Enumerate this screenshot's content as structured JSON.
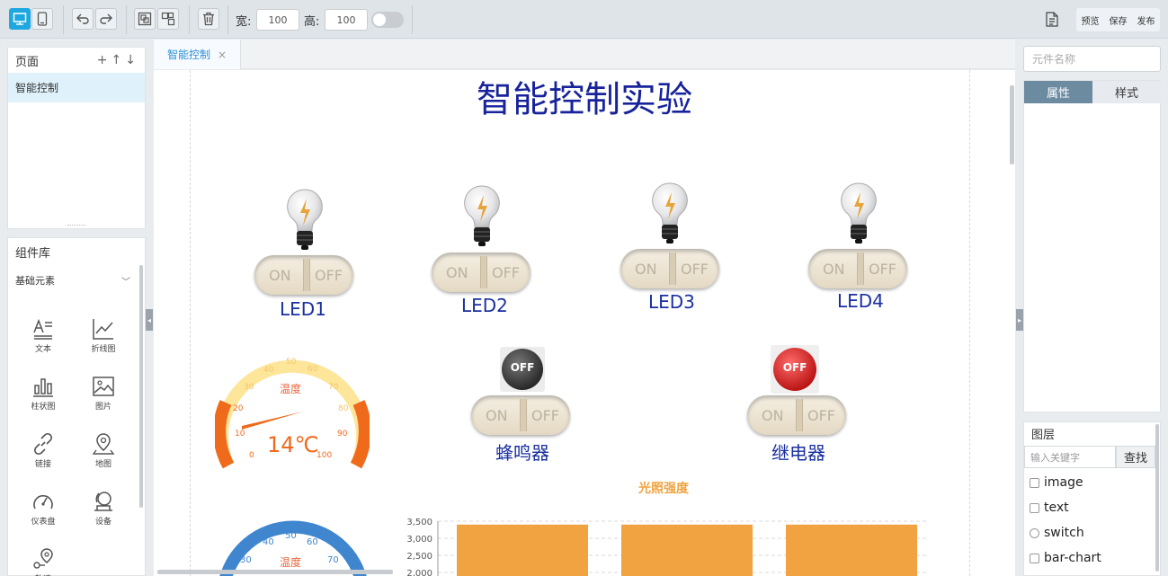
{
  "toolbar": {
    "width_label": "宽:",
    "width_value": "100",
    "height_label": "高:",
    "height_value": "100",
    "preview": "预览",
    "save": "保存",
    "publish": "发布"
  },
  "pages_panel": {
    "title": "页面",
    "items": [
      "智能控制"
    ]
  },
  "component_library": {
    "title": "组件库",
    "category": "基础元素",
    "items": [
      "文本",
      "折线图",
      "柱状图",
      "图片",
      "链接",
      "地图",
      "仪表盘",
      "设备",
      "轨迹"
    ]
  },
  "editor": {
    "tab": "智能控制",
    "tab_close": "×",
    "page_title": "智能控制实验",
    "leds": [
      "LED1",
      "LED2",
      "LED3",
      "LED4"
    ],
    "switch_on": "ON",
    "switch_off": "OFF",
    "buzzer_label": "蜂鸣器",
    "relay_label": "继电器",
    "status_off": "OFF",
    "gauge_temp": {
      "title": "温度",
      "value_text": "14℃",
      "ticks": [
        "0",
        "10",
        "20",
        "30",
        "40",
        "50",
        "60",
        "70",
        "80",
        "90",
        "100"
      ]
    },
    "gauge_humid": {
      "title": "温度",
      "ticks": [
        "30",
        "40",
        "50",
        "60",
        "70"
      ]
    },
    "chart_title": "光照强度"
  },
  "chart_data": {
    "type": "bar",
    "title": "光照强度",
    "categories": [
      "",
      "",
      ""
    ],
    "series": [
      {
        "values": [
          3400,
          3400,
          3400
        ]
      }
    ],
    "y_ticks": [
      "3,500",
      "3,000",
      "2,500",
      "2,000"
    ],
    "ylim": [
      2000,
      3500
    ],
    "color": "#f0a340"
  },
  "right_panel": {
    "search_placeholder": "元件名称",
    "tab_props": "属性",
    "tab_style": "样式"
  },
  "layers": {
    "title": "图层",
    "search_placeholder": "输入关键字",
    "search_btn": "查找",
    "items": [
      "image",
      "text",
      "switch",
      "bar-chart"
    ]
  },
  "colors": {
    "accent": "#1ea7e1",
    "title": "#18239b",
    "bar": "#f0a340"
  }
}
